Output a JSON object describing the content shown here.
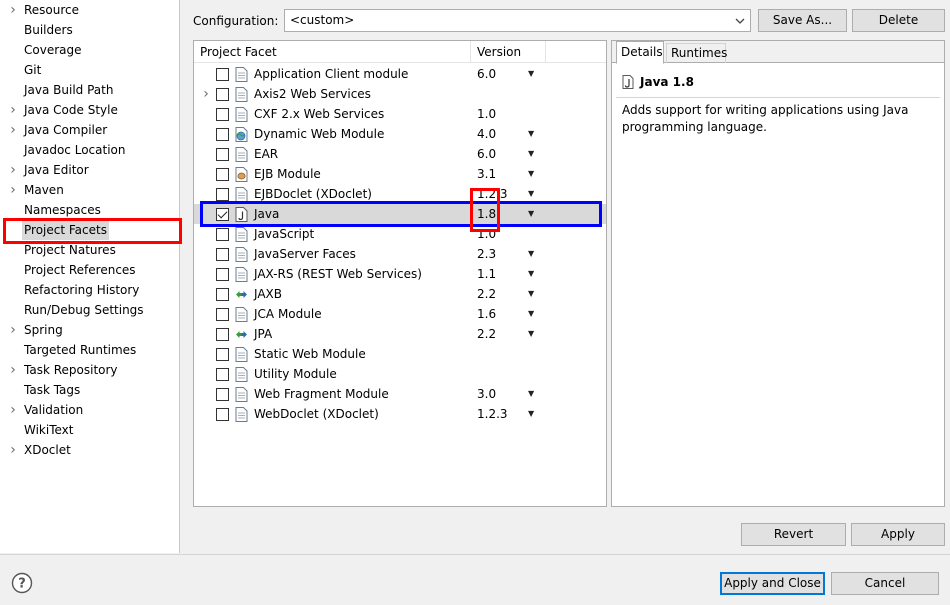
{
  "nav": {
    "items": [
      {
        "label": "Resource",
        "expandable": true
      },
      {
        "label": "Builders",
        "expandable": false
      },
      {
        "label": "Coverage",
        "expandable": false
      },
      {
        "label": "Git",
        "expandable": false
      },
      {
        "label": "Java Build Path",
        "expandable": false
      },
      {
        "label": "Java Code Style",
        "expandable": true
      },
      {
        "label": "Java Compiler",
        "expandable": true
      },
      {
        "label": "Javadoc Location",
        "expandable": false
      },
      {
        "label": "Java Editor",
        "expandable": true
      },
      {
        "label": "Maven",
        "expandable": true
      },
      {
        "label": "Namespaces",
        "expandable": false
      },
      {
        "label": "Project Facets",
        "expandable": false,
        "selected": true
      },
      {
        "label": "Project Natures",
        "expandable": false
      },
      {
        "label": "Project References",
        "expandable": false
      },
      {
        "label": "Refactoring History",
        "expandable": false
      },
      {
        "label": "Run/Debug Settings",
        "expandable": false
      },
      {
        "label": "Spring",
        "expandable": true
      },
      {
        "label": "Targeted Runtimes",
        "expandable": false
      },
      {
        "label": "Task Repository",
        "expandable": true
      },
      {
        "label": "Task Tags",
        "expandable": false
      },
      {
        "label": "Validation",
        "expandable": true
      },
      {
        "label": "WikiText",
        "expandable": false
      },
      {
        "label": "XDoclet",
        "expandable": true
      }
    ]
  },
  "config": {
    "label": "Configuration:",
    "value": "<custom>",
    "save_as": "Save As...",
    "delete": "Delete"
  },
  "facets": {
    "col_facet": "Project Facet",
    "col_version": "Version",
    "rows": [
      {
        "name": "Application Client module",
        "version": "6.0",
        "dropdown": true,
        "checked": false,
        "expandable": false,
        "icon": "page-icon"
      },
      {
        "name": "Axis2 Web Services",
        "version": "",
        "dropdown": false,
        "checked": false,
        "expandable": true,
        "icon": "page-icon"
      },
      {
        "name": "CXF 2.x Web Services",
        "version": "1.0",
        "dropdown": false,
        "checked": false,
        "expandable": false,
        "icon": "page-icon"
      },
      {
        "name": "Dynamic Web Module",
        "version": "4.0",
        "dropdown": true,
        "checked": false,
        "expandable": false,
        "icon": "globe-page-icon"
      },
      {
        "name": "EAR",
        "version": "6.0",
        "dropdown": true,
        "checked": false,
        "expandable": false,
        "icon": "page-icon"
      },
      {
        "name": "EJB Module",
        "version": "3.1",
        "dropdown": true,
        "checked": false,
        "expandable": false,
        "icon": "bean-icon"
      },
      {
        "name": "EJBDoclet (XDoclet)",
        "version": "1.2.3",
        "dropdown": true,
        "checked": false,
        "expandable": false,
        "icon": "page-icon"
      },
      {
        "name": "Java",
        "version": "1.8",
        "dropdown": true,
        "checked": true,
        "expandable": false,
        "icon": "java-file-icon",
        "selected": true
      },
      {
        "name": "JavaScript",
        "version": "1.0",
        "dropdown": false,
        "checked": false,
        "expandable": false,
        "icon": "page-icon"
      },
      {
        "name": "JavaServer Faces",
        "version": "2.3",
        "dropdown": true,
        "checked": false,
        "expandable": false,
        "icon": "page-icon"
      },
      {
        "name": "JAX-RS (REST Web Services)",
        "version": "1.1",
        "dropdown": true,
        "checked": false,
        "expandable": false,
        "icon": "page-icon"
      },
      {
        "name": "JAXB",
        "version": "2.2",
        "dropdown": true,
        "checked": false,
        "expandable": false,
        "icon": "arrows-icon"
      },
      {
        "name": "JCA Module",
        "version": "1.6",
        "dropdown": true,
        "checked": false,
        "expandable": false,
        "icon": "page-icon"
      },
      {
        "name": "JPA",
        "version": "2.2",
        "dropdown": true,
        "checked": false,
        "expandable": false,
        "icon": "arrows-icon"
      },
      {
        "name": "Static Web Module",
        "version": "",
        "dropdown": false,
        "checked": false,
        "expandable": false,
        "icon": "page-icon"
      },
      {
        "name": "Utility Module",
        "version": "",
        "dropdown": false,
        "checked": false,
        "expandable": false,
        "icon": "page-icon"
      },
      {
        "name": "Web Fragment Module",
        "version": "3.0",
        "dropdown": true,
        "checked": false,
        "expandable": false,
        "icon": "page-icon"
      },
      {
        "name": "WebDoclet (XDoclet)",
        "version": "1.2.3",
        "dropdown": true,
        "checked": false,
        "expandable": false,
        "icon": "page-icon"
      }
    ]
  },
  "details": {
    "tab_details": "Details",
    "tab_runtimes": "Runtimes",
    "title": "Java 1.8",
    "description": "Adds support for writing applications using Java programming language."
  },
  "buttons": {
    "revert": "Revert",
    "apply": "Apply",
    "apply_close": "Apply and Close",
    "cancel": "Cancel"
  },
  "colors": {
    "annotation_red": "#ff0000",
    "annotation_blue": "#0000ff",
    "selection": "#d9d9d9",
    "default_button_border": "#0078d7"
  }
}
